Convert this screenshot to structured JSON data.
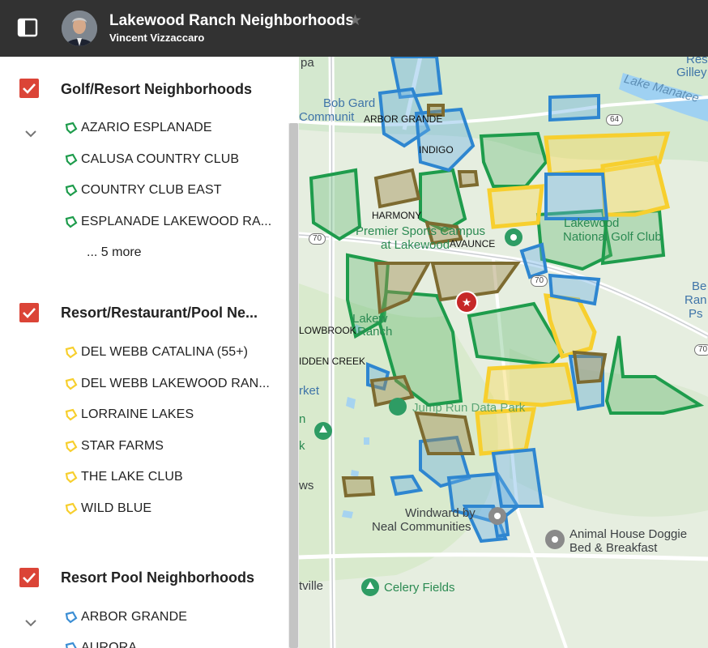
{
  "header": {
    "title": "Lakewood Ranch Neighborhoods",
    "author": "Vincent Vizzaccaro"
  },
  "colors": {
    "header_bg": "#323232",
    "checkbox": "#db4437",
    "golf_resort": "#1e9c4c",
    "resort_restaurant_pool": "#f7cf2e",
    "resort_pool": "#3b8ed4",
    "olive": "#7d6b30"
  },
  "layers": [
    {
      "title": "Golf/Resort Neighborhoods",
      "icon": "polygon-icon-green",
      "items": [
        "AZARIO ESPLANADE",
        "CALUSA COUNTRY CLUB",
        "COUNTRY CLUB EAST",
        "ESPLANADE LAKEWOOD RA..."
      ],
      "more": "... 5 more"
    },
    {
      "title": "Resort/Restaurant/Pool Ne...",
      "icon": "polygon-icon-yellow",
      "items": [
        "DEL WEBB CATALINA (55+)",
        "DEL WEBB LAKEWOOD RAN...",
        "LORRAINE LAKES",
        "STAR FARMS",
        "THE LAKE CLUB",
        "WILD BLUE"
      ]
    },
    {
      "title": "Resort Pool Neighborhoods",
      "icon": "polygon-icon-blue",
      "items": [
        "ARBOR GRANDE",
        "AURORA"
      ]
    }
  ],
  "map": {
    "labels": {
      "pa": "pa",
      "bob_gard": "Bob Gard",
      "communit": "Communit",
      "arbor_grande": "ARBOR GRANDE",
      "indigo": "INDIGO",
      "harmony": "HARMONY",
      "premier_sports": "Premier Sports Campus",
      "at_lakewood": "at Lakewood",
      "avaunce": "AVAUNCE",
      "lakewood_national_1": "Lakewood",
      "lakewood_national_2": "National Golf Club",
      "lake_manatee": "Lake Manatee",
      "res": "Res",
      "gilley": "Gilley",
      "lakew": "Lakew",
      "ranch": "Ranch",
      "lowbrook": "LOWBROOK",
      "idden_creek": "IDDEN CREEK",
      "rket": "rket",
      "n": "n",
      "k": "k",
      "ws": "ws",
      "tville": "tville",
      "jump": "Jump Run Data Park",
      "windward_1": "Windward by",
      "windward_2": "Neal Communities",
      "animal_house_1": "Animal House Doggie",
      "animal_house_2": "Bed & Breakfast",
      "celery_fields": "Celery Fields",
      "be": "Be",
      "ran": "Ran",
      "ps": "Ps",
      "road_64": "64",
      "road_70a": "70",
      "road_70b": "70",
      "road_70c": "70"
    }
  }
}
